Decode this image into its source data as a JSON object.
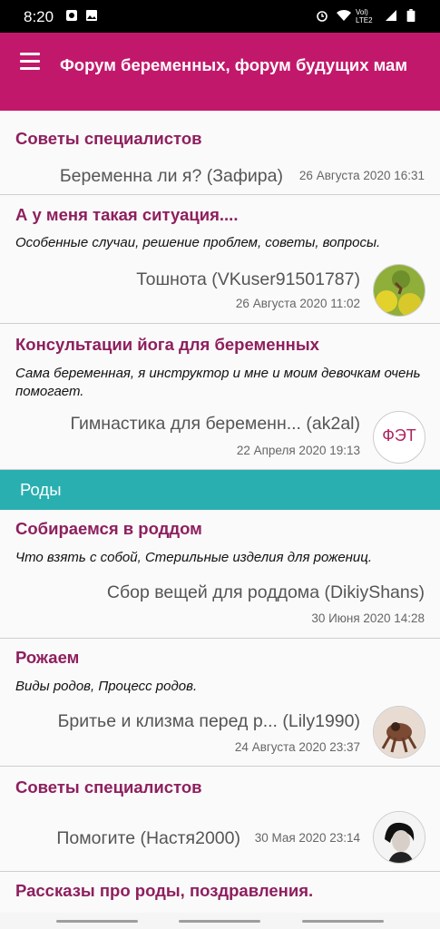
{
  "status": {
    "time": "8:20",
    "signal_label": "Vol) LTE2"
  },
  "appbar": {
    "title": "Форум беременных, форум будущих мам",
    "menu_icon": "hamburger-menu-icon"
  },
  "items": [
    {
      "title": "Советы специалистов",
      "topic": "Беременна ли я? (Зафира)",
      "date": "26 Августа 2020 16:31"
    },
    {
      "title": "А у меня такая ситуация....",
      "description": "Особенные случаи, решение проблем, советы, вопросы.",
      "topic": "Тошнота (VKuser91501787)",
      "date": "26 Августа 2020 11:02"
    },
    {
      "title": "Консультации йога для беременных",
      "description": "Сама беременная, я инструктор и мне и моим девочкам очень помогает.",
      "topic": "Гимнастика для беременн... (ak2al)",
      "date": "22 Апреля 2020 19:13",
      "avatar_text": "ФЭТ"
    },
    {
      "title": "Собираемся в роддом",
      "description": "Что взять с собой, Стерильные изделия для рожениц.",
      "topic": "Сбор вещей для роддома (DikiyShans)",
      "date": "30 Июня 2020 14:28"
    },
    {
      "title": "Рожаем",
      "description": "Виды родов, Процесс родов.",
      "topic": "Бритье и клизма перед р... (Lily1990)",
      "date": "24 Августа 2020 23:37"
    },
    {
      "title": "Советы специалистов",
      "topic": "Помогите (Настя2000)",
      "date": "30 Мая 2020 23:14"
    },
    {
      "title": "Рассказы про роды, поздравления."
    }
  ],
  "section": {
    "label": "Роды",
    "color": "#2aafb0"
  },
  "colors": {
    "accent": "#c2186b",
    "title_text": "#8e1f5e"
  }
}
